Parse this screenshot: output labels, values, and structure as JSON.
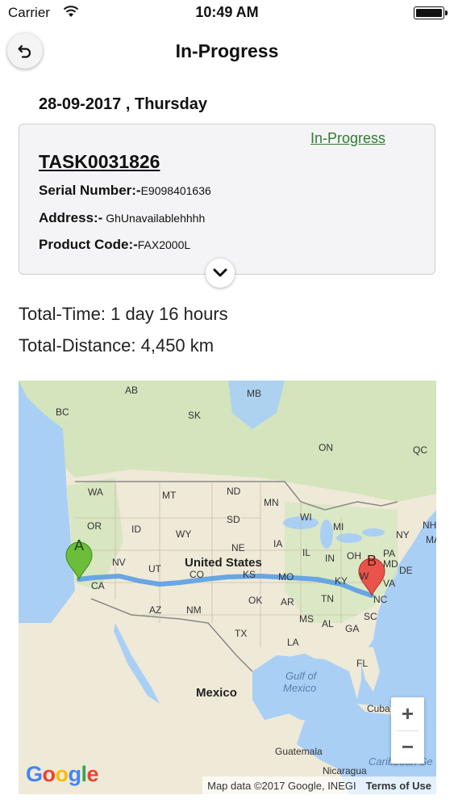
{
  "status_bar": {
    "carrier": "Carrier",
    "time": "10:49 AM"
  },
  "nav": {
    "title": "In-Progress",
    "back_icon": "back-arrow-icon"
  },
  "date_line": "28-09-2017 , Thursday",
  "task": {
    "status": "In-Progress",
    "id": "TASK0031826",
    "serial_label": "Serial Number:-",
    "serial_value": "E9098401636",
    "address_label": "Address:-",
    "address_value": " GhUnavailablehhhh",
    "product_label": "Product Code:-",
    "product_value": "FAX2000L"
  },
  "totals": {
    "time": "Total-Time: 1 day 16 hours",
    "distance": "Total-Distance: 4,450 km"
  },
  "map": {
    "labels": {
      "ab": "AB",
      "mb": "MB",
      "bc": "BC",
      "sk": "SK",
      "on": "ON",
      "qc": "QC",
      "wa": "WA",
      "mt": "MT",
      "nd": "ND",
      "mn": "MN",
      "or": "OR",
      "id": "ID",
      "sd": "SD",
      "wi": "WI",
      "mi": "MI",
      "ny": "NY",
      "nh": "NH",
      "ma": "MA",
      "wy": "WY",
      "ne": "NE",
      "ia": "IA",
      "nv": "NV",
      "ut": "UT",
      "il": "IL",
      "in": "IN",
      "oh": "OH",
      "pa": "PA",
      "md": "MD",
      "de": "DE",
      "ca": "CA",
      "co": "CO",
      "ks": "KS",
      "mo": "MO",
      "ky": "KY",
      "wv": "W",
      "va": "VA",
      "az": "AZ",
      "nm": "NM",
      "ok": "OK",
      "ar": "AR",
      "tn": "TN",
      "nc": "NC",
      "ms": "MS",
      "al": "AL",
      "ga": "GA",
      "sc": "SC",
      "tx": "TX",
      "la": "LA",
      "fl": "FL",
      "cuba": "Cuba",
      "guatemala": "Guatemala",
      "nicaragua": "Nicaragua",
      "caribbean": "Caribbean Se"
    },
    "country_us": "United States",
    "country_mexico": "Mexico",
    "gulf_line1": "Gulf of",
    "gulf_line2": "Mexico",
    "marker_a": "A",
    "marker_b": "B",
    "zoom_in": "+",
    "zoom_out": "−",
    "logo": "Google",
    "attribution": "Map data ©2017 Google, INEGI",
    "terms": "Terms of Use",
    "colors": {
      "route": "#5a9ee6",
      "marker_a": "#6bbd3a",
      "marker_b": "#e8544a",
      "water": "#a9cff5",
      "land": "#efe9d8"
    }
  }
}
